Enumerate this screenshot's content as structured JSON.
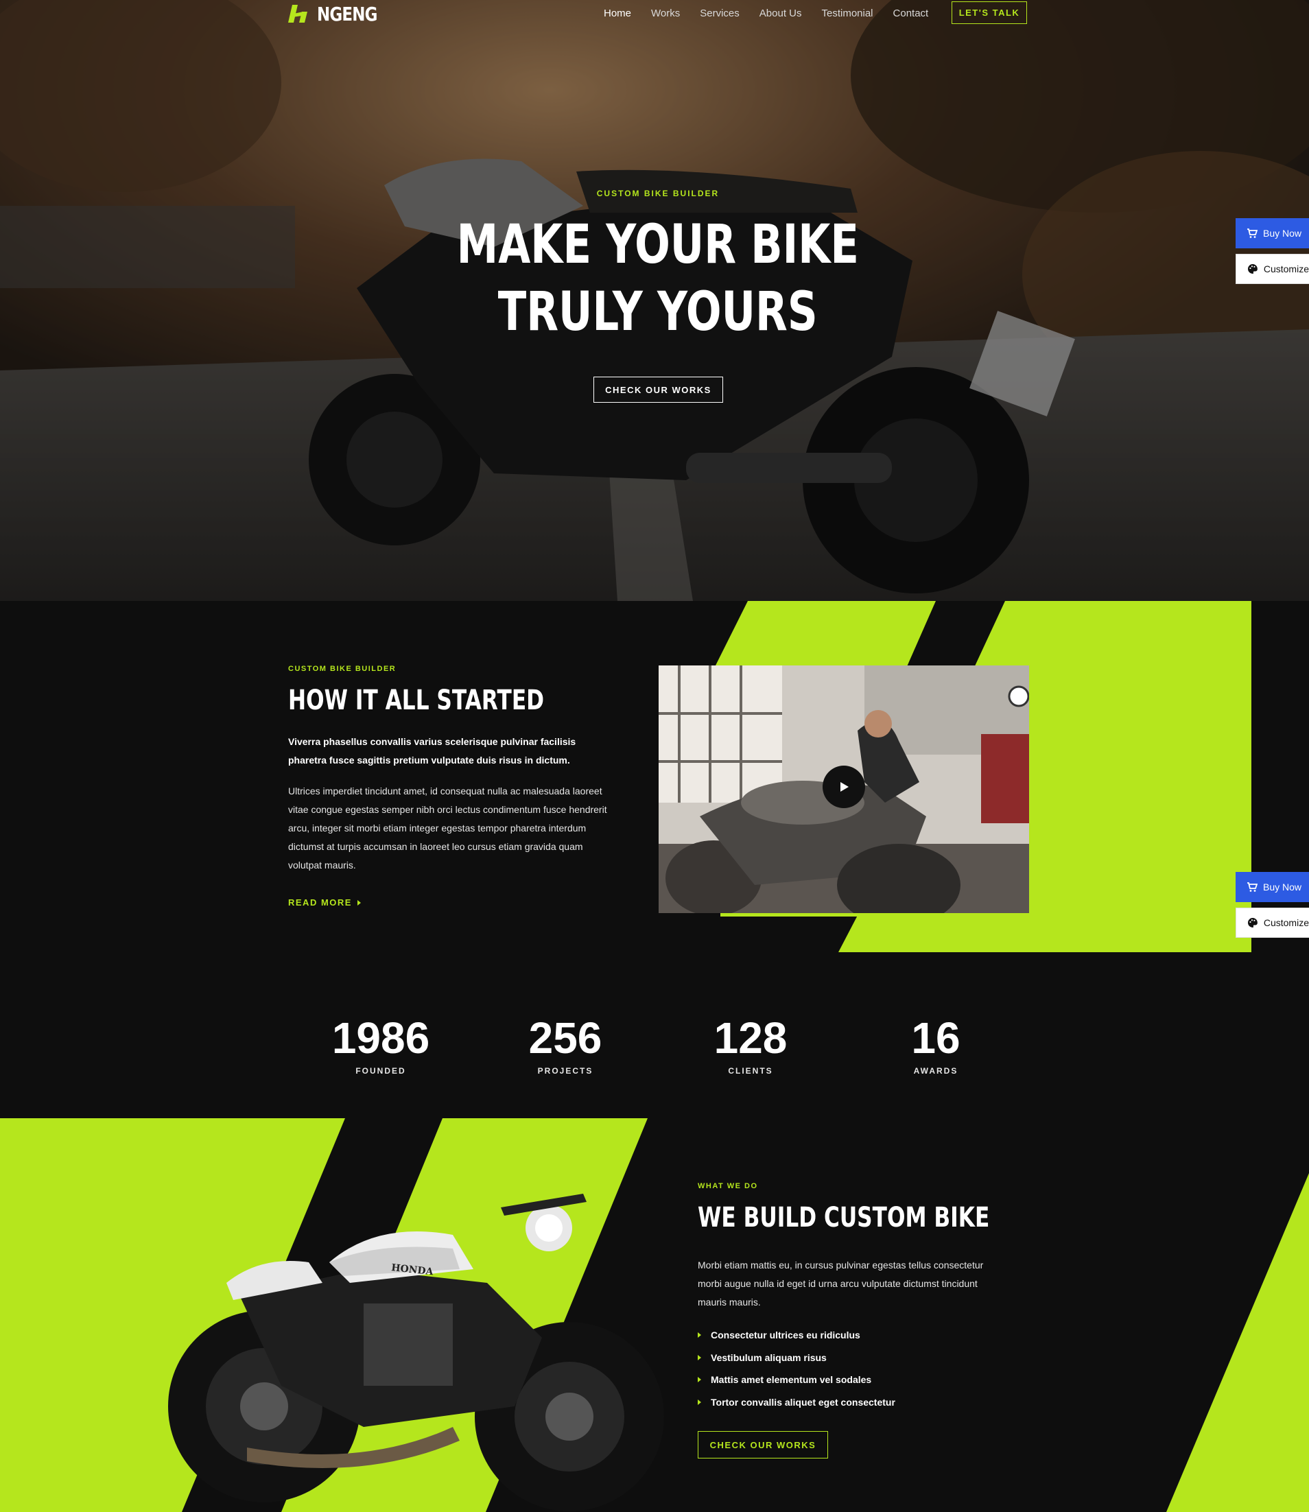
{
  "brand": {
    "name": "NGENG",
    "accent": "#b5e61d",
    "dark": "#0e0e0e",
    "buy_blue": "#2d5be3"
  },
  "nav": {
    "items": [
      {
        "label": "Home",
        "active": true
      },
      {
        "label": "Works"
      },
      {
        "label": "Services"
      },
      {
        "label": "About Us"
      },
      {
        "label": "Testimonial"
      },
      {
        "label": "Contact"
      }
    ],
    "cta": "LET'S TALK"
  },
  "hero": {
    "kicker": "CUSTOM BIKE BUILDER",
    "title_line1": "MAKE YOUR BIKE",
    "title_line2": "TRULY YOURS",
    "button": "CHECK OUR WORKS"
  },
  "side_widget": {
    "buy": "Buy Now",
    "customize": "Customize"
  },
  "story": {
    "kicker": "CUSTOM BIKE BUILDER",
    "title": "HOW IT ALL STARTED",
    "lead": "Viverra phasellus convallis varius scelerisque pulvinar facilisis pharetra fusce sagittis pretium vulputate duis risus in dictum.",
    "body": "Ultrices imperdiet tincidunt amet, id consequat nulla ac malesuada laoreet vitae congue egestas semper nibh orci lectus condimentum fusce hendrerit arcu, integer sit morbi etiam integer egestas tempor pharetra interdum dictumst at turpis accumsan in laoreet leo cursus etiam gravida quam volutpat mauris.",
    "more": "READ MORE"
  },
  "stats": [
    {
      "value": "1986",
      "label": "FOUNDED"
    },
    {
      "value": "256",
      "label": "PROJECTS"
    },
    {
      "value": "128",
      "label": "CLIENTS"
    },
    {
      "value": "16",
      "label": "AWARDS"
    }
  ],
  "build": {
    "kicker": "WHAT WE DO",
    "title": "WE BUILD CUSTOM BIKE",
    "body": "Morbi etiam mattis eu, in cursus pulvinar egestas tellus consectetur morbi augue nulla id eget id urna arcu vulputate dictumst tincidunt mauris mauris.",
    "list": [
      "Consectetur ultrices eu ridiculus",
      "Vestibulum aliquam risus",
      "Mattis amet elementum vel sodales",
      "Tortor convallis aliquet eget consectetur"
    ],
    "button": "CHECK OUR WORKS",
    "bike_tank_text": "HONDA"
  }
}
